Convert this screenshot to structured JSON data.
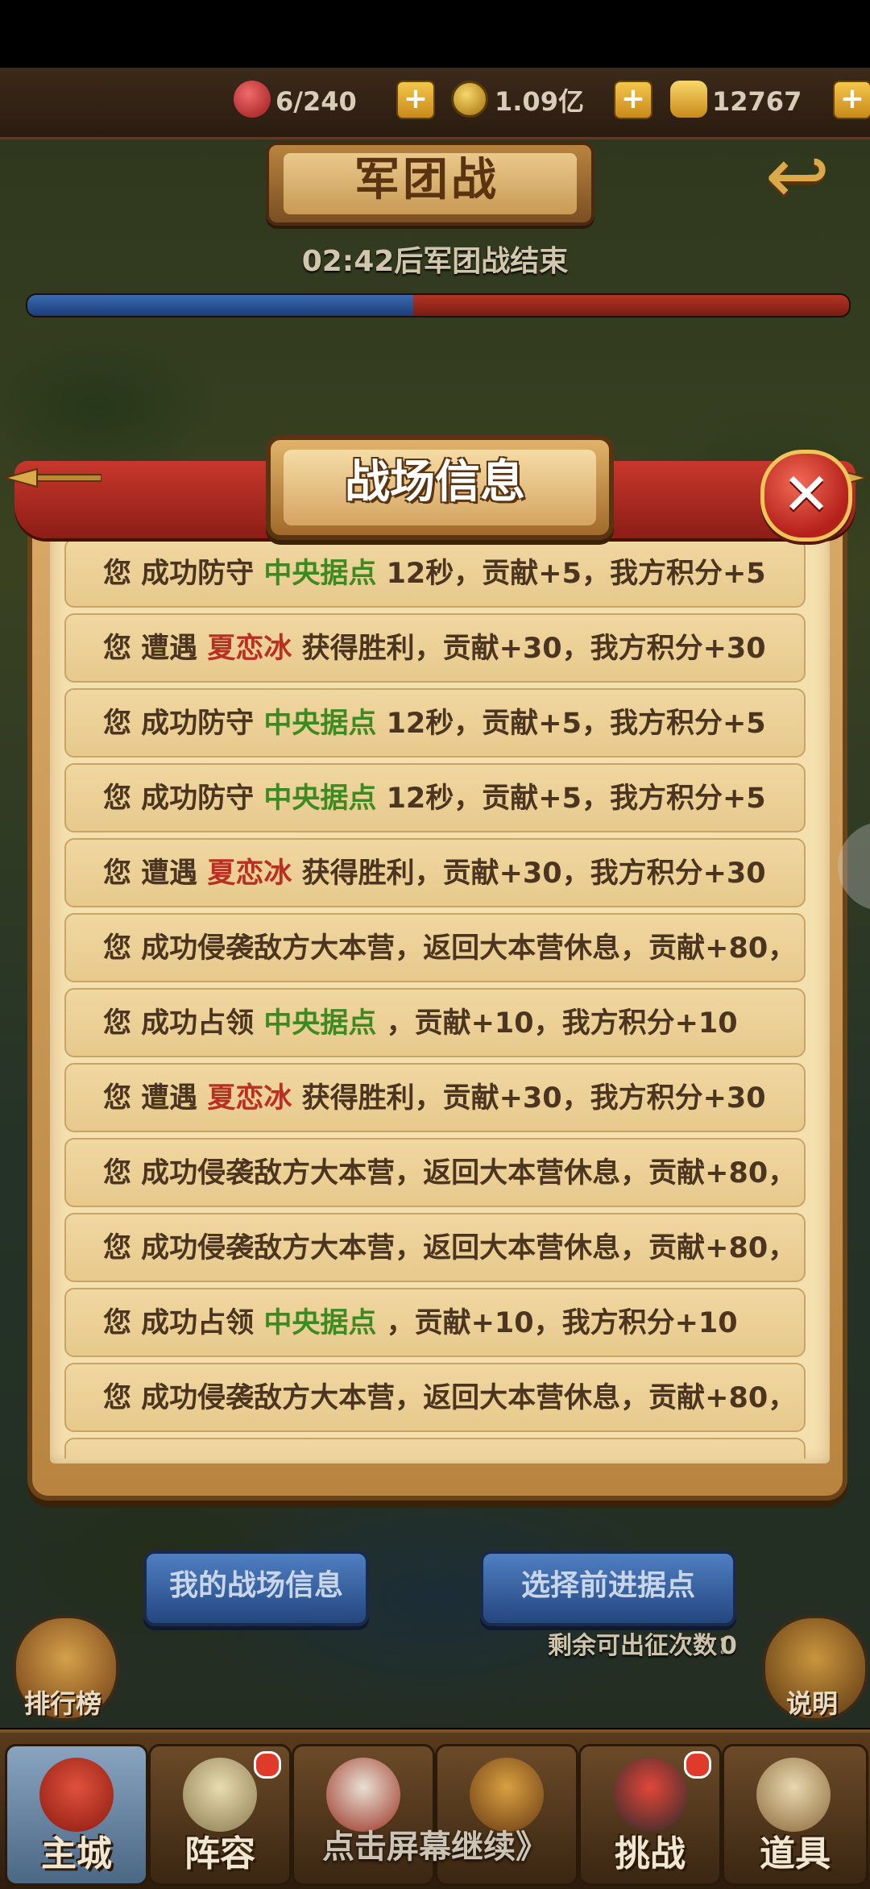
{
  "resources": {
    "gems": "6/240",
    "coins": "1.09亿",
    "ingots": "12767"
  },
  "header": {
    "title": "军团战",
    "countdown": "02:42后军团战结束",
    "progress": {
      "blue_fraction": 0.47
    }
  },
  "popup": {
    "title": "战场信息",
    "close": "✕",
    "rows": [
      {
        "pre": "您 成功防守 ",
        "hl": "中央据点",
        "hl_color": "green",
        "post": " 12秒，贡献+5，我方积分+5"
      },
      {
        "pre": "您 遭遇 ",
        "hl": "夏恋冰",
        "hl_color": "red",
        "post": " 获得胜利，贡献+30，我方积分+30"
      },
      {
        "pre": "您 成功防守 ",
        "hl": "中央据点",
        "hl_color": "green",
        "post": " 12秒，贡献+5，我方积分+5"
      },
      {
        "pre": "您 成功防守 ",
        "hl": "中央据点",
        "hl_color": "green",
        "post": " 12秒，贡献+5，我方积分+5"
      },
      {
        "pre": "您 遭遇 ",
        "hl": "夏恋冰",
        "hl_color": "red",
        "post": " 获得胜利，贡献+30，我方积分+30"
      },
      {
        "pre": "您 成功侵袭敌方大本营，返回大本营休息，贡献+80，",
        "hl": "",
        "hl_color": "",
        "post": ""
      },
      {
        "pre": "您 成功占领 ",
        "hl": "中央据点",
        "hl_color": "green",
        "post": " ，贡献+10，我方积分+10"
      },
      {
        "pre": "您 遭遇 ",
        "hl": "夏恋冰",
        "hl_color": "red",
        "post": " 获得胜利，贡献+30，我方积分+30"
      },
      {
        "pre": "您 成功侵袭敌方大本营，返回大本营休息，贡献+80，",
        "hl": "",
        "hl_color": "",
        "post": ""
      },
      {
        "pre": "您 成功侵袭敌方大本营，返回大本营休息，贡献+80，",
        "hl": "",
        "hl_color": "",
        "post": ""
      },
      {
        "pre": "您 成功占领 ",
        "hl": "中央据点",
        "hl_color": "green",
        "post": " ，贡献+10，我方积分+10"
      },
      {
        "pre": "您 成功侵袭敌方大本营，返回大本营休息，贡献+80，",
        "hl": "",
        "hl_color": "",
        "post": ""
      },
      {
        "pre": "",
        "hl": "",
        "hl_color": "",
        "post": ""
      }
    ]
  },
  "buttons": {
    "my_info": "我的战场信息",
    "choose_point": "选择前进据点"
  },
  "remaining": {
    "label": "剩余可出征次数：",
    "value": "0"
  },
  "side": {
    "ranking": "排行榜",
    "help": "说明"
  },
  "nav": [
    "主城",
    "阵容",
    "",
    "",
    "挑战",
    "道具"
  ],
  "continue_hint": "点击屏幕继续》",
  "colors": {
    "green": "#3d8a22",
    "red": "#b92f22",
    "accent_gold": "#e1b36a"
  }
}
